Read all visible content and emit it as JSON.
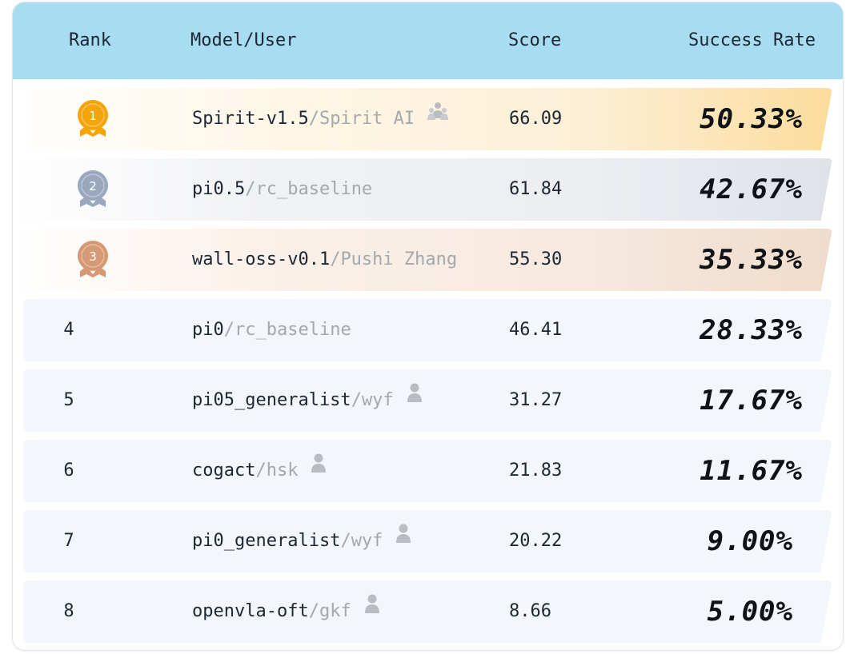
{
  "header": {
    "rank": "Rank",
    "model": "Model/User",
    "score": "Score",
    "rate": "Success Rate"
  },
  "rows": [
    {
      "rank": "1",
      "name": "Spirit-v1.5",
      "sep": "/",
      "user": "Spirit AI",
      "user_icon": "group-icon",
      "score": "66.09",
      "rate": "50.33%",
      "medal": "gold"
    },
    {
      "rank": "2",
      "name": "pi0.5",
      "sep": "/",
      "user": "rc_baseline",
      "user_icon": "",
      "score": "61.84",
      "rate": "42.67%",
      "medal": "silver"
    },
    {
      "rank": "3",
      "name": "wall-oss-v0.1",
      "sep": "/",
      "user": "Pushi Zhang",
      "user_icon": "",
      "score": "55.30",
      "rate": "35.33%",
      "medal": "bronze"
    },
    {
      "rank": "4",
      "name": "pi0",
      "sep": "/",
      "user": "rc_baseline",
      "user_icon": "",
      "score": "46.41",
      "rate": "28.33%",
      "medal": ""
    },
    {
      "rank": "5",
      "name": "pi05_generalist",
      "sep": "/",
      "user": "wyf",
      "user_icon": "person-icon",
      "score": "31.27",
      "rate": "17.67%",
      "medal": ""
    },
    {
      "rank": "6",
      "name": "cogact",
      "sep": "/",
      "user": "hsk",
      "user_icon": "person-icon",
      "score": "21.83",
      "rate": "11.67%",
      "medal": ""
    },
    {
      "rank": "7",
      "name": "pi0_generalist",
      "sep": "/",
      "user": "wyf",
      "user_icon": "person-icon",
      "score": "20.22",
      "rate": "9.00%",
      "medal": ""
    },
    {
      "rank": "8",
      "name": "openvla-oft",
      "sep": "/",
      "user": "gkf",
      "user_icon": "person-icon",
      "score": "8.66",
      "rate": "5.00%",
      "medal": ""
    }
  ],
  "colors": {
    "header_bg": "#a8dcf0",
    "gold": "#f5a50b",
    "silver": "#9aa8bf",
    "bronze": "#d49a74",
    "muted_text": "#a3a8ad"
  }
}
